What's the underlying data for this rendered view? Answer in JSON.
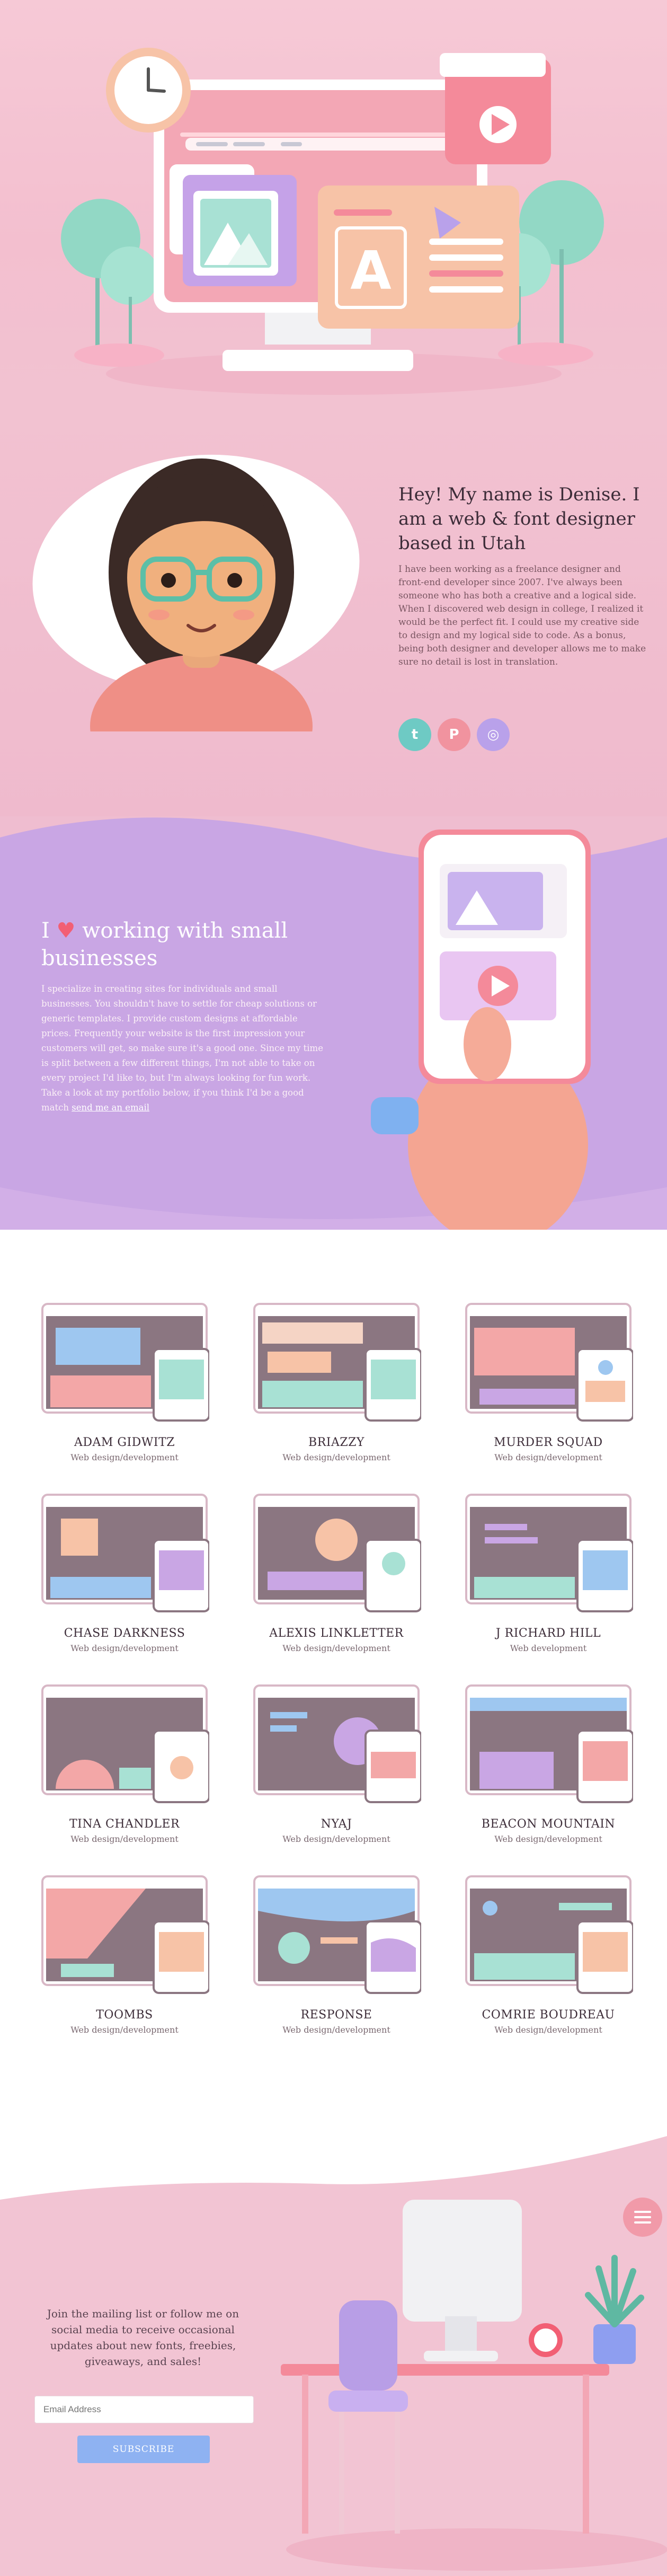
{
  "colors": {
    "pink_bg": "#f2c2d1",
    "lilac": "#c9a3e6",
    "accent_salmon": "#f19aa9",
    "button_blue": "#8eb2f2",
    "twitter": "#6ecac4",
    "pinterest": "#f1939f",
    "instagram": "#b9a1ea"
  },
  "about": {
    "heading": "Hey! My name is Denise. I am a web & font designer based in Utah",
    "bio": "I have been working as a freelance designer and front-end developer since 2007. I've always been someone who has both a creative and a logical side. When I discovered web design in college, I realized it would be the perfect fit. I could use my creative side to design and my logical side to code. As a bonus, being both designer and developer allows me to make sure no detail is lost in translation.",
    "social": [
      {
        "name": "twitter-icon",
        "glyph": "t"
      },
      {
        "name": "pinterest-icon",
        "glyph": "P"
      },
      {
        "name": "instagram-icon",
        "glyph": "◎"
      }
    ]
  },
  "love": {
    "heading_prefix": "I",
    "heart": "♥",
    "heading_rest": "working with small businesses",
    "text": "I specialize in creating sites for individuals and small businesses. You shouldn't have to settle for cheap solutions or generic templates. I provide custom designs at affordable prices. Frequently your website is the first impression your customers will get, so make sure it's a good one. Since my time is split between a few different things, I'm not able to take on every project I'd like to, but I'm always looking for fun work. Take a look at my portfolio below, if you think I'd be a good match",
    "link": "send me an email"
  },
  "portfolio": {
    "items": [
      {
        "title": "ADAM GIDWITZ",
        "subtitle": "Web design/development"
      },
      {
        "title": "BRIAZZY",
        "subtitle": "Web design/development"
      },
      {
        "title": "MURDER SQUAD",
        "subtitle": "Web design/development"
      },
      {
        "title": "CHASE DARKNESS",
        "subtitle": "Web design/development"
      },
      {
        "title": "ALEXIS LINKLETTER",
        "subtitle": "Web design/development"
      },
      {
        "title": "J RICHARD HILL",
        "subtitle": "Web development"
      },
      {
        "title": "TINA CHANDLER",
        "subtitle": "Web design/development"
      },
      {
        "title": "NYAJ",
        "subtitle": "Web design/development"
      },
      {
        "title": "BEACON MOUNTAIN",
        "subtitle": "Web design/development"
      },
      {
        "title": "TOOMBS",
        "subtitle": "Web design/development"
      },
      {
        "title": "RESPONSE",
        "subtitle": "Web design/development"
      },
      {
        "title": "COMRIE BOUDREAU",
        "subtitle": "Web design/development"
      }
    ]
  },
  "footer": {
    "text": "Join the mailing list or follow me on social media to receive occasional updates about new fonts, freebies, giveaways, and sales!",
    "email_placeholder": "Email Address",
    "subscribe_label": "SUBSCRIBE"
  }
}
